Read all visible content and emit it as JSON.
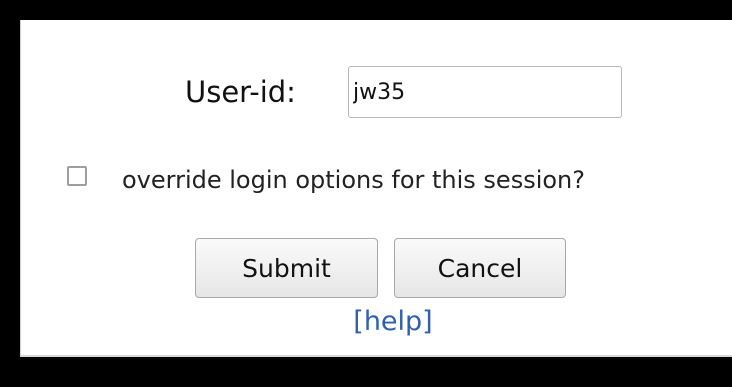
{
  "login_form": {
    "userid_label": "User-id:",
    "userid_value": "jw35",
    "override_label": "override login options for this session?",
    "override_checked": false,
    "submit_label": "Submit",
    "cancel_label": "Cancel",
    "help_label": "[help]"
  },
  "colors": {
    "page_background": "#000000",
    "panel_background": "#ffffff",
    "link": "#2f5fb3"
  }
}
